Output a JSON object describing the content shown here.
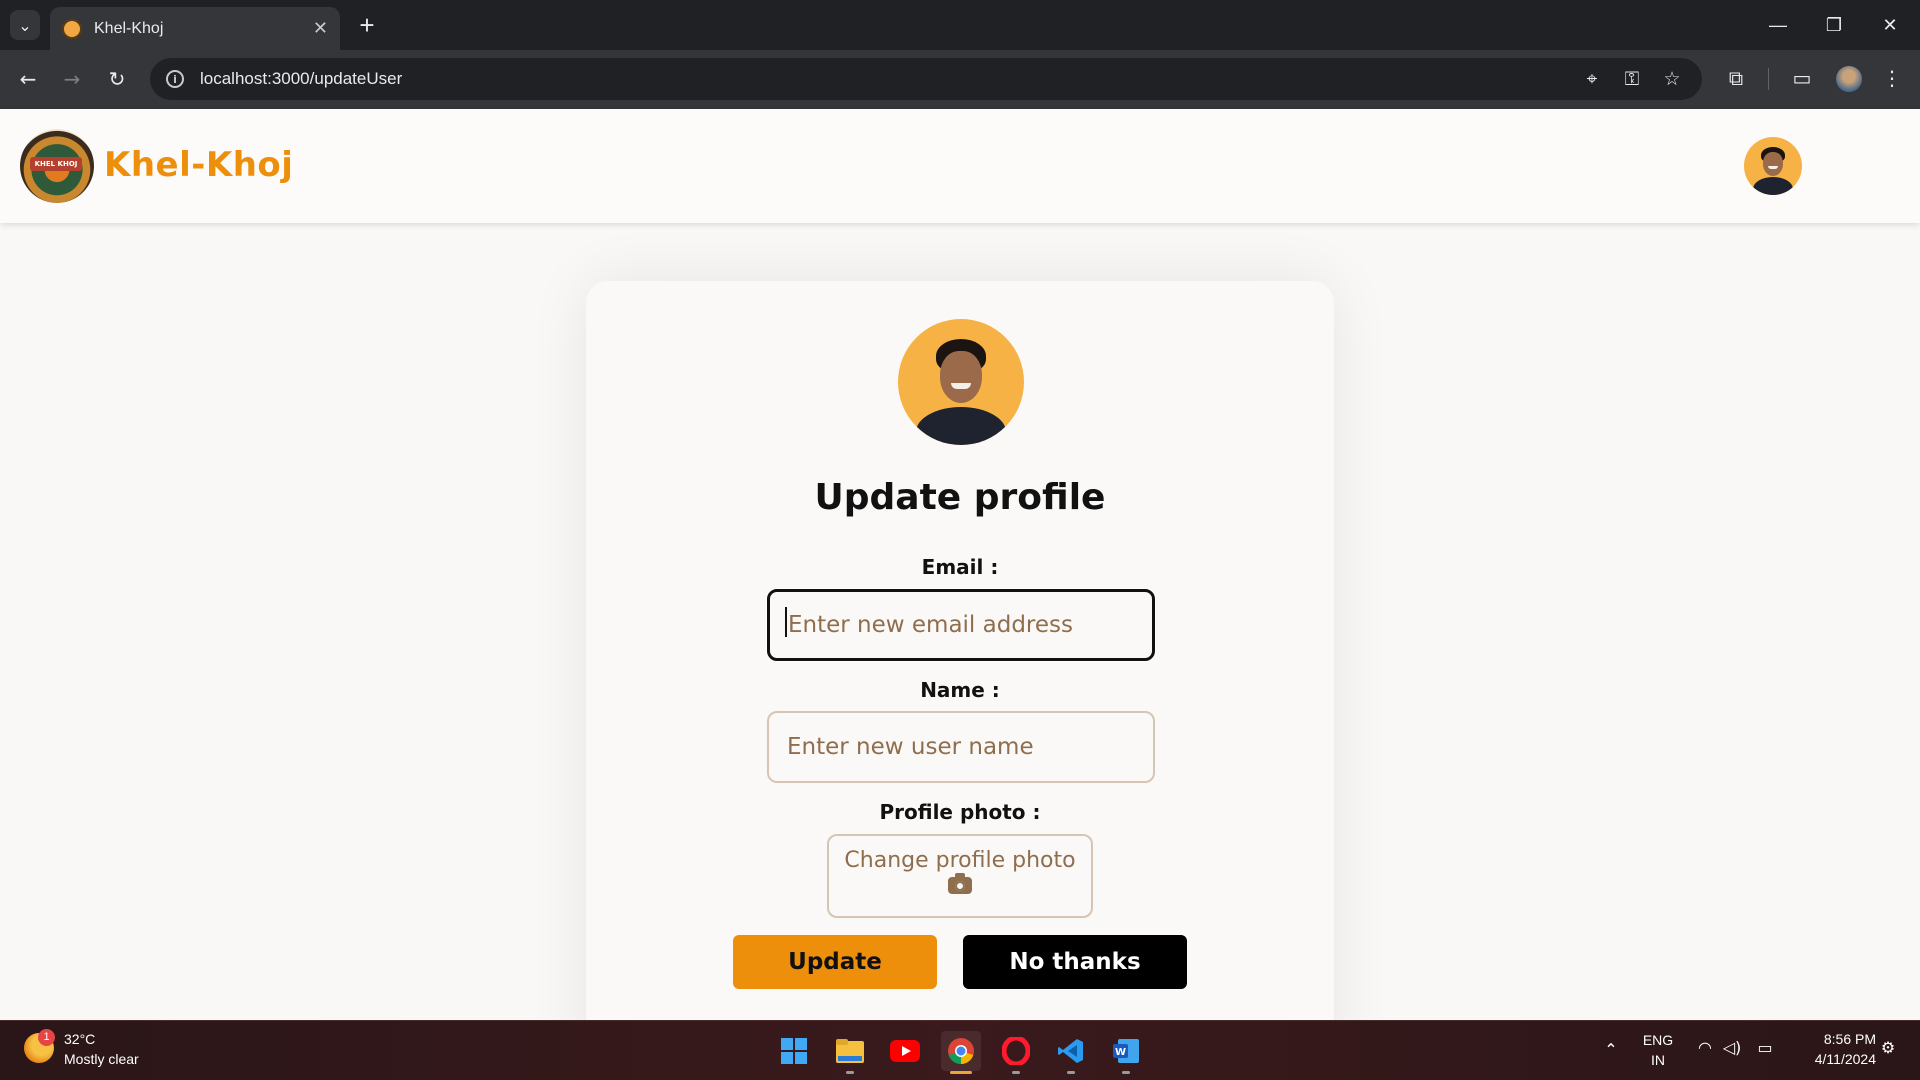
{
  "browser": {
    "tab_title": "Khel-Khoj",
    "tab_close": "✕",
    "new_tab": "+",
    "url": "localhost:3000/updateUser",
    "window_controls": {
      "minimize": "—",
      "restore": "❐",
      "close": "✕"
    }
  },
  "header": {
    "brand": "Khel-Khoj",
    "logo_text": "KHEL KHOJ"
  },
  "form": {
    "title": "Update profile",
    "email": {
      "label": "Email :",
      "placeholder": "Enter new email address",
      "value": ""
    },
    "name": {
      "label": "Name :",
      "placeholder": "Enter new user name",
      "value": ""
    },
    "photo": {
      "label": "Profile photo :",
      "button": "Change profile photo"
    },
    "buttons": {
      "update": "Update",
      "cancel": "No thanks"
    }
  },
  "taskbar": {
    "weather": {
      "temp": "32°C",
      "desc": "Mostly clear",
      "badge": "1"
    },
    "lang_top": "ENG",
    "lang_bottom": "IN",
    "time": "8:56 PM",
    "date": "4/11/2024"
  },
  "colors": {
    "accent": "#ee8f0c",
    "avatar_bg": "#f7b246",
    "border": "#d7c5b3",
    "placeholder": "#8f6e4e"
  }
}
